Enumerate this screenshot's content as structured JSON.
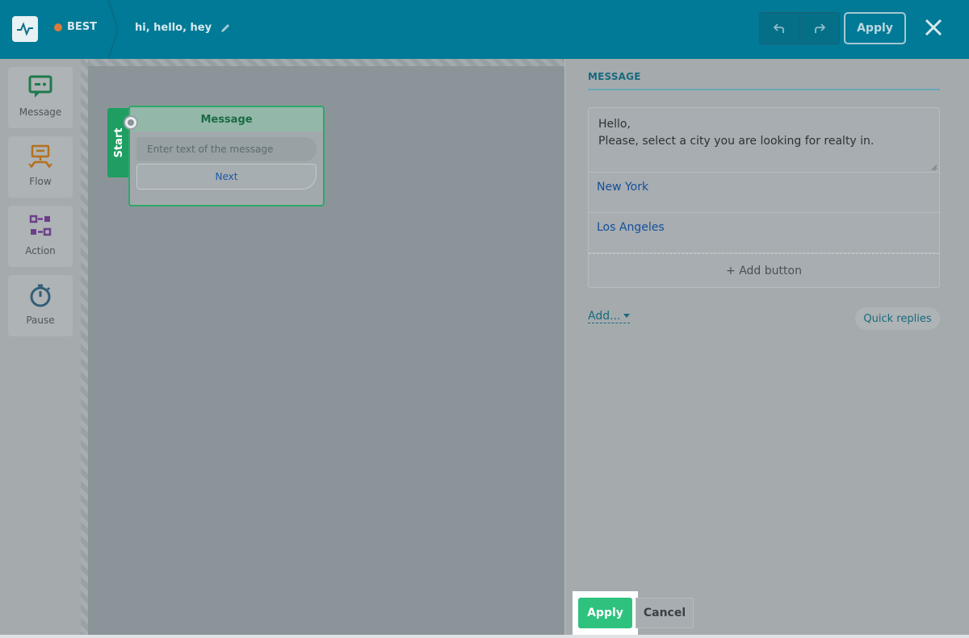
{
  "header": {
    "bot_name": "BEST",
    "flow_name": "hi, hello, hey",
    "apply_label": "Apply"
  },
  "tools": [
    {
      "label": "Message",
      "icon": "message-icon",
      "color": "#1f7a4d"
    },
    {
      "label": "Flow",
      "icon": "flow-icon",
      "color": "#b5701f"
    },
    {
      "label": "Action",
      "icon": "action-icon",
      "color": "#6d3f8a"
    },
    {
      "label": "Pause",
      "icon": "pause-timer-icon",
      "color": "#335e76"
    }
  ],
  "canvas": {
    "start_label": "Start",
    "node": {
      "title": "Message",
      "placeholder": "Enter text of the message",
      "button_label": "Next"
    }
  },
  "panel": {
    "title": "MESSAGE",
    "message_text": "Hello,\nPlease, select a city you are looking for realty in.",
    "buttons": [
      "New York",
      "Los Angeles"
    ],
    "add_button_label": "+ Add button",
    "add_menu_label": "Add...",
    "quick_replies_label": "Quick replies"
  },
  "footer": {
    "apply_label": "Apply",
    "cancel_label": "Cancel"
  },
  "colors": {
    "header_bg": "#007a96",
    "accent_green": "#2ec27e",
    "status_dot": "#d97b3b"
  }
}
